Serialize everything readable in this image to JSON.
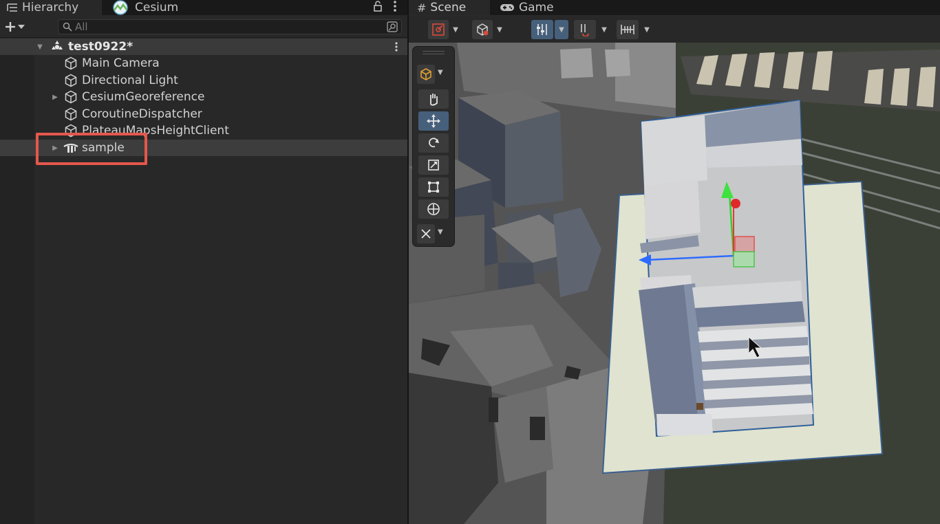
{
  "hierarchy": {
    "tab_label": "Hierarchy",
    "cesium_tab_label": "Cesium",
    "lock_icon": "lock-icon",
    "search_placeholder": "All",
    "scene": {
      "name": "test0922*"
    },
    "items": [
      {
        "label": "Main Camera",
        "icon": "gameobject-cube-icon",
        "expandable": false
      },
      {
        "label": "Directional Light",
        "icon": "gameobject-cube-icon",
        "expandable": false
      },
      {
        "label": "CesiumGeoreference",
        "icon": "gameobject-cube-icon",
        "expandable": true
      },
      {
        "label": "CoroutineDispatcher",
        "icon": "gameobject-cube-icon",
        "expandable": false
      },
      {
        "label": "PlateauMapsHeightClient",
        "icon": "gameobject-cube-icon",
        "expandable": false
      },
      {
        "label": "sample",
        "icon": "model-prefab-icon",
        "expandable": true,
        "selected": true
      }
    ]
  },
  "scene_view": {
    "tab_label": "Scene",
    "game_tab_label": "Game",
    "tools": [
      "hand-tool",
      "move-tool",
      "rotate-tool",
      "scale-tool",
      "rect-tool",
      "transform-tool"
    ],
    "active_tool": "move-tool"
  },
  "colors": {
    "highlight": "#e5574c",
    "active_button": "#46607c",
    "panel_bg": "#282828"
  }
}
